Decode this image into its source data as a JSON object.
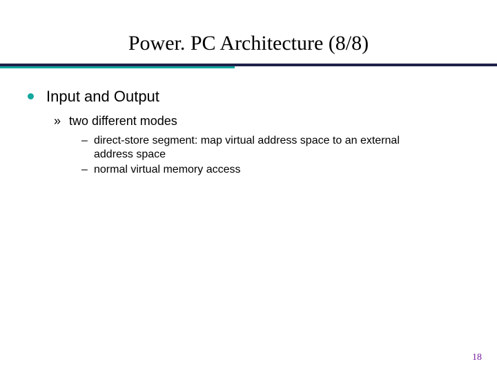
{
  "slide": {
    "title": "Power. PC Architecture (8/8)",
    "page_number": "18",
    "bullets": {
      "l1": {
        "text": "Input and Output"
      },
      "l2": {
        "marker": "»",
        "text": "two different modes"
      },
      "l3a": {
        "marker": "–",
        "text": "direct-store segment: map virtual address space to an external address space"
      },
      "l3b": {
        "marker": "–",
        "text": "normal virtual memory access"
      }
    }
  }
}
